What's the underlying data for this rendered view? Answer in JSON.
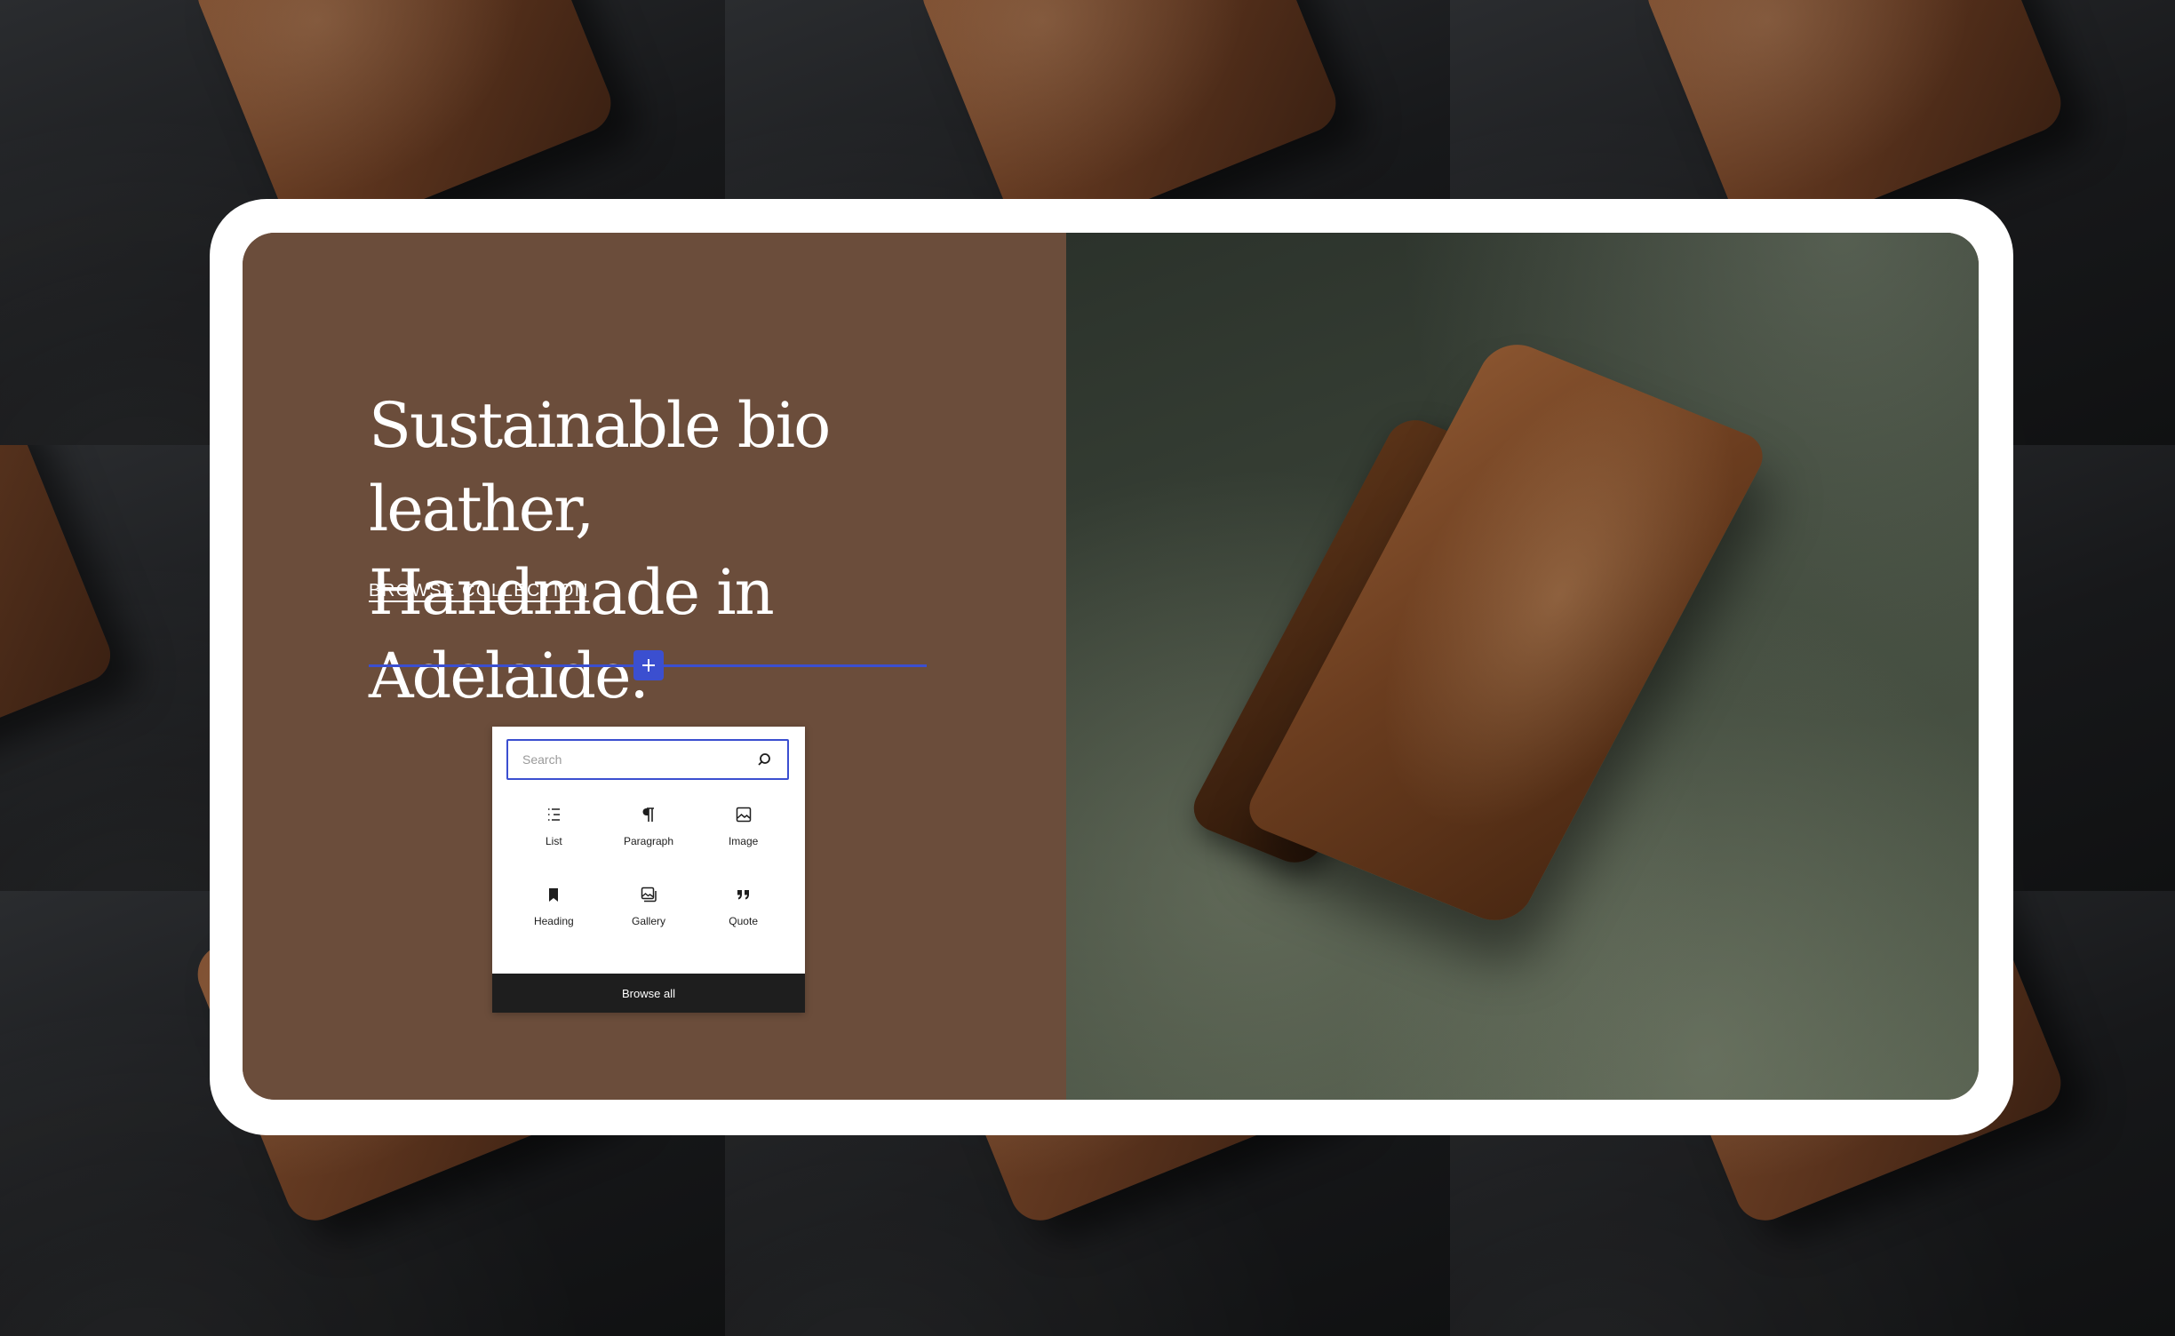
{
  "hero": {
    "headline_line1": "Sustainable bio leather,",
    "headline_line2": "Handmade in Adelaide.",
    "cta_label": "BROWSE COLLECTION"
  },
  "inserter": {
    "search_placeholder": "Search",
    "blocks": [
      {
        "label": "List",
        "icon": "list-icon"
      },
      {
        "label": "Paragraph",
        "icon": "paragraph-icon"
      },
      {
        "label": "Image",
        "icon": "image-icon"
      },
      {
        "label": "Heading",
        "icon": "heading-icon"
      },
      {
        "label": "Gallery",
        "icon": "gallery-icon"
      },
      {
        "label": "Quote",
        "icon": "quote-icon"
      }
    ],
    "browse_all_label": "Browse all"
  },
  "colors": {
    "panel_brown": "#6b4d3b",
    "accent_blue": "#3b4fd0",
    "browse_bar": "#1e1e1e"
  }
}
